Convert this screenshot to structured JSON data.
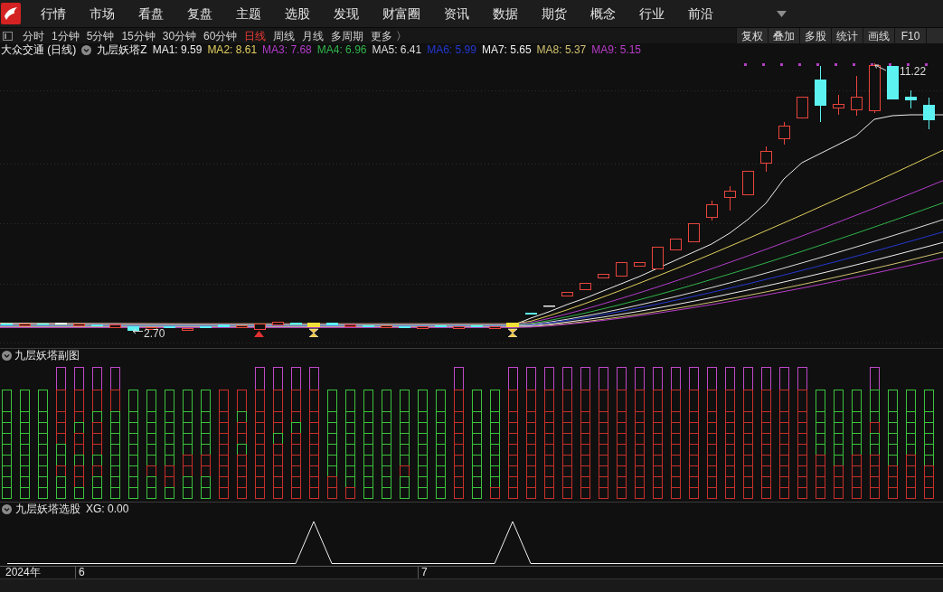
{
  "menu_bar": {
    "items": [
      "行情",
      "市场",
      "看盘",
      "复盘",
      "主题",
      "选股",
      "发现",
      "财富圈",
      "资讯",
      "数据",
      "期货",
      "概念",
      "行业",
      "前沿"
    ]
  },
  "period_bar": {
    "periods": [
      {
        "label": "分时",
        "selected": false
      },
      {
        "label": "1分钟",
        "selected": false
      },
      {
        "label": "5分钟",
        "selected": false
      },
      {
        "label": "15分钟",
        "selected": false
      },
      {
        "label": "30分钟",
        "selected": false
      },
      {
        "label": "60分钟",
        "selected": false
      },
      {
        "label": "日线",
        "selected": true
      },
      {
        "label": "周线",
        "selected": false
      },
      {
        "label": "月线",
        "selected": false
      },
      {
        "label": "多周期",
        "selected": false
      }
    ],
    "more": "更多 〉",
    "tools": [
      "复权",
      "叠加",
      "多股",
      "统计",
      "画线",
      "F10"
    ]
  },
  "legend": {
    "title": "大众交通 (日线)",
    "indicator": "九层妖塔Z",
    "moving_averages": [
      {
        "text": "MA1: 9.59",
        "color": "#eeeeee"
      },
      {
        "text": "MA2: 8.61",
        "color": "#e2cf5e"
      },
      {
        "text": "MA3: 7.68",
        "color": "#b03cc8"
      },
      {
        "text": "MA4: 6.96",
        "color": "#2fb34a"
      },
      {
        "text": "MA5: 6.41",
        "color": "#dddddd"
      },
      {
        "text": "MA6: 5.99",
        "color": "#2438d0"
      },
      {
        "text": "MA7: 5.65",
        "color": "#eeeeee"
      },
      {
        "text": "MA8: 5.37",
        "color": "#cfc070"
      },
      {
        "text": "MA9: 5.15",
        "color": "#b83cc8"
      }
    ]
  },
  "main_chart": {
    "high_label": "11.22",
    "low_label": "2.70"
  },
  "sub_chart_1": {
    "title": "九层妖塔副图"
  },
  "sub_chart_2": {
    "title": "九层妖塔选股",
    "reading": "XG: 0.00"
  },
  "time_axis": {
    "labels": [
      "2024年",
      "6",
      "7"
    ]
  }
}
